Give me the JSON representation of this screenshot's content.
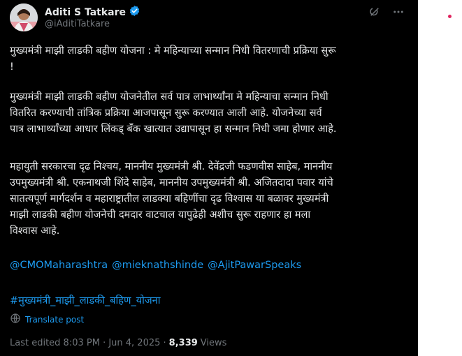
{
  "tweet": {
    "author_name": "Aditi S Tatkare",
    "author_handle": "@iAditiTatkare",
    "verified": true,
    "paragraph1": "मुख्यमंत्री माझी लाडकी बहीण योजना : मे महिन्याच्या सन्मान निधी वितरणाची प्रक्रिया सुरू\n!",
    "paragraph2": "मुख्यमंत्री माझी लाडकी बहीण योजनेतील सर्व पात्र लाभार्थ्यांना मे महिन्याचा सन्मान निधी\nवितरित करण्याची तांत्रिक प्रक्रिया आजपासून सुरू करण्यात आली आहे. योजनेच्या सर्व\nपात्र लाभार्थ्यांच्या आधार लिंकड् बँक खात्यात उद्यापासून हा सन्मान निधी जमा होणार आहे.",
    "paragraph3": "महायुती सरकारचा दृढ निश्चय, माननीय मुख्यमंत्री श्री. देवेंद्रजी फडणवीस साहेब, माननीय\nउपमुख्यमंत्री श्री. एकनाथजी शिंदे साहेब, माननीय उपमुख्यमंत्री श्री. अजितदादा पवार यांचे\nसातत्यपूर्ण मार्गदर्शन व महाराष्ट्रातील लाडक्या बहिणींचा दृढ विश्वास या बळावर मुख्यमंत्री\nमाझी लाडकी बहीण योजनेची दमदार वाटचाल यापुढेही अशीच सुरू राहणार हा मला\nविश्वास आहे.",
    "mentions": [
      "@CMOMaharashtra",
      "@mieknathshinde",
      "@AjitPawarSpeaks"
    ],
    "hashtag": "#मुख्यमंत्री_माझी_लाडकी_बहिण_योजना",
    "translate_label": "Translate post",
    "last_edited": "Last edited 8:03 PM · Jun 4, 2025 · ",
    "views_count": "8,339",
    "views_label": "Views"
  },
  "icons": {
    "verified": "verified-badge-icon",
    "grok": "grok-icon",
    "more": "more-icon",
    "translate": "translate-icon"
  },
  "colors": {
    "background": "#000000",
    "text": "#e7e9ea",
    "secondary": "#71767b",
    "accent": "#1d9bf0"
  }
}
